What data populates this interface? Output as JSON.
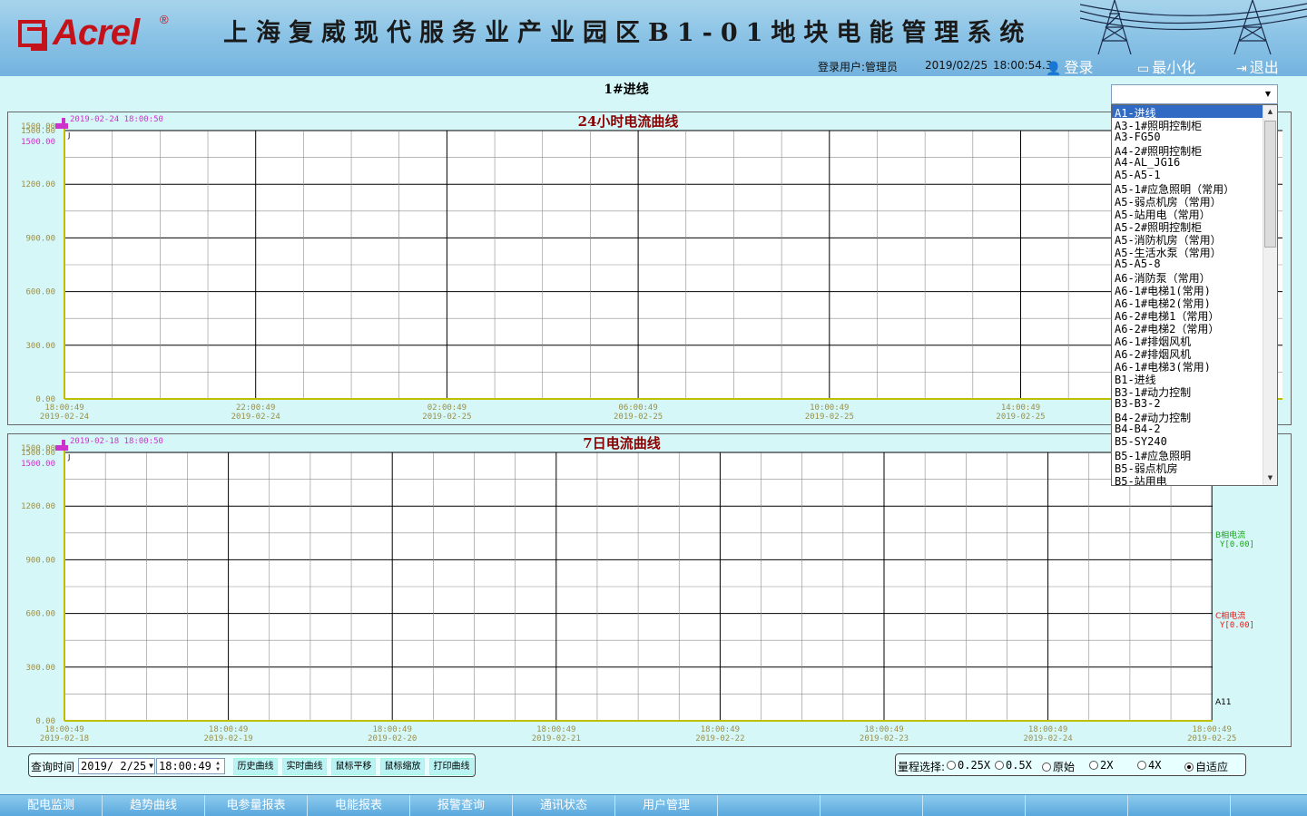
{
  "header": {
    "logo": "Acrel",
    "logo_reg": "®",
    "title": "上海复威现代服务业产业园区B1-01地块电能管理系统",
    "user_label": "登录用户:管理员",
    "date": "2019/02/25",
    "time": "18:00:54.3",
    "login": "登录",
    "minimize": "最小化",
    "logout": "退出"
  },
  "page_title": "1#进线",
  "circuit_selector": {
    "value": "",
    "options": [
      "A1-进线",
      "A3-1#照明控制柜",
      "A3-FG50",
      "A4-2#照明控制柜",
      "A4-AL_JG16",
      "A5-A5-1",
      "A5-1#应急照明（常用）",
      "A5-弱点机房（常用）",
      "A5-站用电（常用）",
      "A5-2#照明控制柜",
      "A5-消防机房（常用）",
      "A5-生活水泵（常用）",
      "A5-A5-8",
      "A6-消防泵（常用）",
      "A6-1#电梯1(常用)",
      "A6-1#电梯2(常用)",
      "A6-2#电梯1（常用）",
      "A6-2#电梯2（常用）",
      "A6-1#排烟风机",
      "A6-2#排烟风机",
      "A6-1#电梯3(常用)",
      "B1-进线",
      "B3-1#动力控制",
      "B3-B3-2",
      "B4-2#动力控制",
      "B4-B4-2",
      "B5-SY240",
      "B5-1#应急照明",
      "B5-弱点机房",
      "B5-站用电"
    ],
    "selected_index": 0
  },
  "charts": [
    {
      "cursor_label": "2019-02-24 18:00:50",
      "y_top_extra": "1500.00",
      "y_ticks": [
        "0.00",
        "300.00",
        "600.00",
        "900.00",
        "1200.00",
        "1500.00"
      ],
      "cursor_value": "1500.00",
      "x_labels": [
        {
          "time": "18:00:49",
          "date": "2019-02-24"
        },
        {
          "time": "22:00:49",
          "date": "2019-02-24"
        },
        {
          "time": "02:00:49",
          "date": "2019-02-25"
        },
        {
          "time": "06:00:49",
          "date": "2019-02-25"
        },
        {
          "time": "10:00:49",
          "date": "2019-02-25"
        },
        {
          "time": "14:00:49",
          "date": "2019-02-25"
        }
      ],
      "side_labels": []
    },
    {
      "cursor_label": "2019-02-18 18:00:50",
      "y_top_extra": "1500.00",
      "y_ticks": [
        "0.00",
        "300.00",
        "600.00",
        "900.00",
        "1200.00",
        "1500.00"
      ],
      "cursor_value": "1500.00",
      "x_labels": [
        {
          "time": "18:00:49",
          "date": "2019-02-18"
        },
        {
          "time": "18:00:49",
          "date": "2019-02-19"
        },
        {
          "time": "18:00:49",
          "date": "2019-02-20"
        },
        {
          "time": "18:00:49",
          "date": "2019-02-21"
        },
        {
          "time": "18:00:49",
          "date": "2019-02-22"
        },
        {
          "time": "18:00:49",
          "date": "2019-02-23"
        },
        {
          "time": "18:00:49",
          "date": "2019-02-24"
        },
        {
          "time": "18:00:49",
          "date": "2019-02-25"
        }
      ],
      "side_labels": [
        {
          "name": "B相电流",
          "value": "Y[0.00]",
          "color": "#1aa51a"
        },
        {
          "name": "C相电流",
          "value": "Y[0.00]",
          "color": "#e31a1a"
        },
        {
          "name": "A11",
          "value": "",
          "color": "#000000"
        }
      ]
    }
  ],
  "chart_data": [
    {
      "type": "line",
      "title": "24小时电流曲线",
      "ylim": [
        0,
        1500
      ],
      "yticks": [
        0,
        300,
        600,
        900,
        1200,
        1500
      ],
      "x": [
        "2019-02-24 18:00:49",
        "2019-02-24 22:00:49",
        "2019-02-25 02:00:49",
        "2019-02-25 06:00:49",
        "2019-02-25 10:00:49",
        "2019-02-25 14:00:49"
      ],
      "series": [],
      "grid": true
    },
    {
      "type": "line",
      "title": "7日电流曲线",
      "ylim": [
        0,
        1500
      ],
      "yticks": [
        0,
        300,
        600,
        900,
        1200,
        1500
      ],
      "x": [
        "2019-02-18 18:00:49",
        "2019-02-19 18:00:49",
        "2019-02-20 18:00:49",
        "2019-02-21 18:00:49",
        "2019-02-22 18:00:49",
        "2019-02-23 18:00:49",
        "2019-02-24 18:00:49",
        "2019-02-25 18:00:49"
      ],
      "series": [
        {
          "name": "B相电流",
          "values": [
            0
          ]
        },
        {
          "name": "C相电流",
          "values": [
            0
          ]
        }
      ],
      "grid": true
    }
  ],
  "toolbar": {
    "query_label": "查询时间",
    "date_value": "2019/ 2/25",
    "time_value": "18:00:49",
    "buttons": [
      "历史曲线",
      "实时曲线",
      "鼠标平移",
      "鼠标缩放",
      "打印曲线"
    ]
  },
  "range": {
    "label": "量程选择:",
    "options": [
      "0.25X",
      "0.5X",
      "原始",
      "2X",
      "4X",
      "自适应"
    ],
    "selected": "自适应"
  },
  "nav": {
    "items": [
      "配电监测",
      "趋势曲线",
      "电参量报表",
      "电能报表",
      "报警查询",
      "通讯状态",
      "用户管理",
      "",
      "",
      "",
      "",
      "",
      ""
    ]
  },
  "colors": {
    "accent": "#316ac5",
    "grid_major": "#000000",
    "grid_minor": "#8c8c8c",
    "axis": "#bfbf00",
    "cursor": "#cc33cc",
    "title": "#8b0000"
  }
}
